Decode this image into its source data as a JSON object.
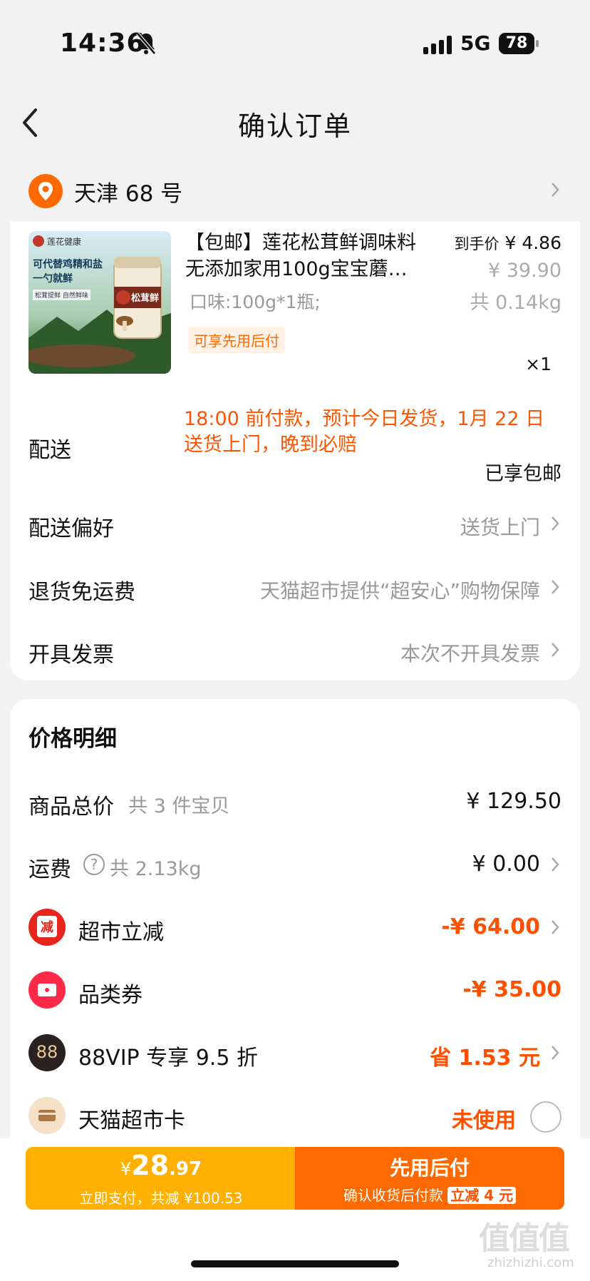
{
  "status": {
    "time": "14:36",
    "network": "5G",
    "battery": "78"
  },
  "nav": {
    "title": "确认订单"
  },
  "address": {
    "text": "天津 68 号"
  },
  "product": {
    "title_line1": "【包邮】莲花松茸鲜调味料",
    "title_line2": "无添加家用100g宝宝蘑…",
    "flavor": "口味:100g*1瓶;",
    "tag": "可享先用后付",
    "price_label": "到手价",
    "price": "¥ 4.86",
    "original_price": "¥ 39.90",
    "weight": "共 0.14kg",
    "quantity": "×1",
    "image": {
      "brand": "莲花健康",
      "slogan_line1": "可代替鸡精和盐",
      "slogan_line2": "一勺就鲜",
      "sub": "松茸提鲜 自然鲜味",
      "jar_label": "松茸鲜"
    }
  },
  "delivery": {
    "label": "配送",
    "note_line1": "18:00 前付款，预计今日发货，1月 22 日",
    "note_line2": "送货上门，晚到必赔",
    "free": "已享包邮"
  },
  "rows": [
    {
      "label": "配送偏好",
      "value": "送货上门"
    },
    {
      "label": "退货免运费",
      "value": "天猫超市提供“超安心”购物保障"
    },
    {
      "label": "开具发票",
      "value": "本次不开具发票"
    }
  ],
  "price_detail": {
    "title": "价格明细",
    "goods_total_label": "商品总价",
    "goods_total_sub": "共 3 件宝贝",
    "goods_total": "¥ 129.50",
    "shipping_label": "运费",
    "shipping_sub": "共 2.13kg",
    "shipping": "¥ 0.00",
    "market_discount_label": "超市立减",
    "market_discount": "-¥ 64.00",
    "market_icon_char": "减",
    "coupon_label": "品类券",
    "coupon": "-¥ 35.00",
    "vip_label": "88VIP 专享 9.5 折",
    "vip_icon_char": "88",
    "vip_value": "省 1.53 元",
    "card_label": "天猫超市卡",
    "card_value": "未使用"
  },
  "bottom_bar": {
    "pay_price_symbol": "¥",
    "pay_price_int": "28",
    "pay_price_dec": ".97",
    "pay_sub": "立即支付，共减 ¥100.53",
    "later_title": "先用后付",
    "later_sub": "确认收货后付款",
    "later_badge": "立减 4 元"
  },
  "watermark": {
    "text": "值值值",
    "site": "zhizhizhi.com"
  },
  "colors": {
    "accent": "#ff5000",
    "orange": "#ff6a00",
    "yellow": "#ffb000"
  }
}
